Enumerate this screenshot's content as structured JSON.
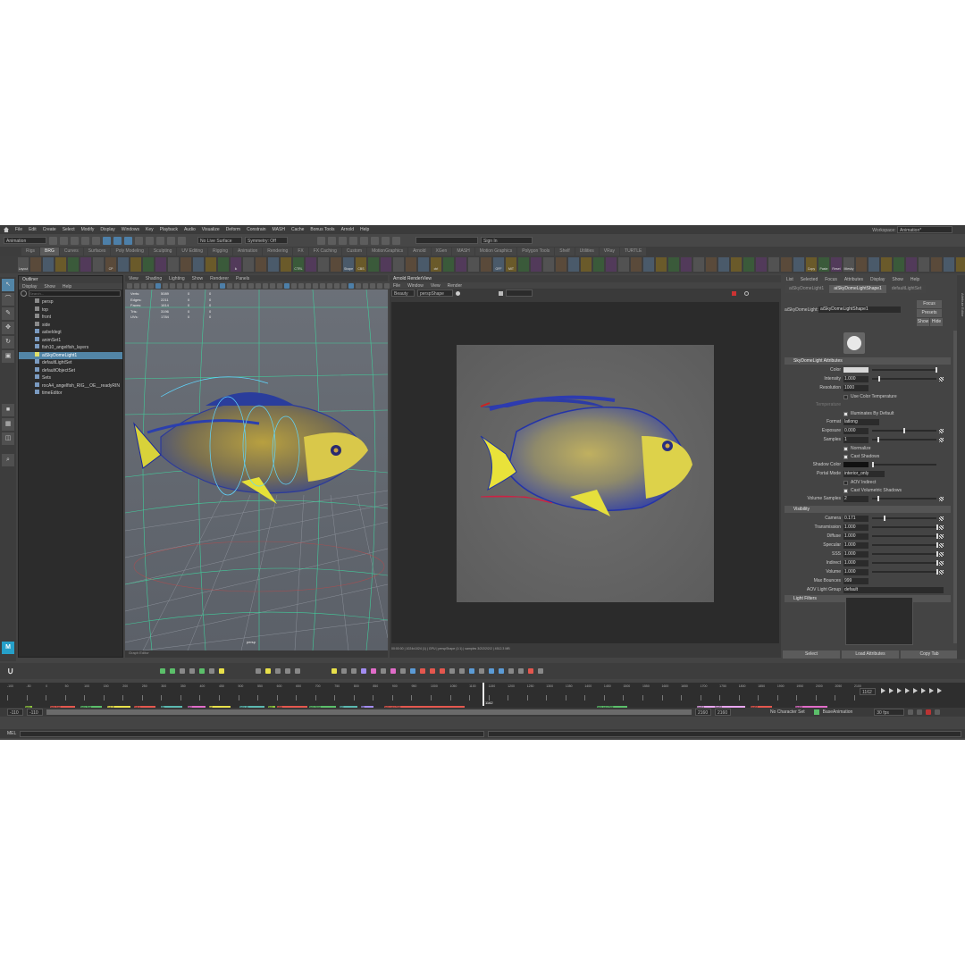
{
  "menubar": {
    "items": [
      "File",
      "Edit",
      "Create",
      "Select",
      "Modify",
      "Display",
      "Windows",
      "Key",
      "Playback",
      "Audio",
      "Visualize",
      "Deform",
      "Constrain",
      "MASH",
      "Cache",
      "Bonus Tools",
      "Arnold",
      "Help"
    ],
    "workspace_label": "Workspace:",
    "workspace_value": "Animation*"
  },
  "statusline": {
    "menuset": "Animation",
    "symmetry": "No Live Surface",
    "symmetry2": "Symmetry: Off",
    "signin": "Sign In"
  },
  "shelf": {
    "tabs": [
      "Rigs",
      "BRG",
      "Curves",
      "Surfaces",
      "Poly Modeling",
      "Sculpting",
      "UV Editing",
      "Rigging",
      "Animation",
      "Rendering",
      "FX",
      "FX Caching",
      "Custom",
      "MotionGraphics",
      "Arnold",
      "XGen",
      "MASH",
      "Motion Graphics",
      "Polygon Tools",
      "Shelf",
      "Utilities",
      "VRay",
      "TURTLE"
    ],
    "active_tab": "BRG",
    "items": [
      "Layout",
      "",
      "",
      "",
      "",
      "",
      "",
      "CP",
      "",
      "",
      "",
      "",
      "",
      "",
      "",
      "",
      "",
      "ik",
      "",
      "",
      "",
      "",
      "CTRL",
      "",
      "",
      "",
      "Shape",
      "CBS",
      "",
      "",
      "",
      "",
      "",
      "ctrl",
      "",
      "",
      "",
      "",
      "OFF",
      "MIT",
      "",
      "",
      "",
      "",
      "",
      "",
      "",
      "",
      "",
      "",
      "",
      "",
      "",
      "",
      "",
      "",
      "",
      "",
      "",
      "",
      "",
      "",
      "",
      "Copy Name",
      "Paste Name",
      "Reset ALL",
      "Miesky",
      "",
      "",
      "",
      "",
      "",
      "",
      "",
      "",
      "",
      "",
      "",
      "",
      "",
      "",
      "",
      "",
      "",
      "",
      "",
      "",
      ""
    ]
  },
  "outliner": {
    "title": "Outliner",
    "menus": [
      "Display",
      "Show",
      "Help"
    ],
    "search_placeholder": "Search...",
    "items": [
      "persp",
      "top",
      "front",
      "side",
      "asbeldegt",
      "animSet1",
      "fish10_angelfish_layers",
      "aiSkyDomeLight1",
      "defaultLightSet",
      "defaultObjectSet",
      "Sets",
      "rocA4_angelfish_RIG__OE__readyRIN",
      "timeEditor"
    ],
    "selected_index": 7
  },
  "viewport": {
    "menus": [
      "View",
      "Shading",
      "Lighting",
      "Show",
      "Renderer",
      "Panels"
    ],
    "hud_labels": [
      "Verts:",
      "Edges:",
      "Faces:",
      "Tris:",
      "UVs:"
    ],
    "hud_values": [
      "5089",
      "2211",
      "1614",
      "3196",
      "1784"
    ],
    "hud_zero": "0",
    "camera_label": "persp",
    "graph_editor": "Graph Editor"
  },
  "render_view": {
    "title": "Arnold RenderView",
    "menus": [
      "File",
      "Window",
      "View",
      "Render"
    ],
    "aov": "Beauty",
    "camera": "perspShape",
    "status": "00:00:00 | 1024x1024 (1) | GPU | perspShape (1:1) | samples 3/2/2/2/2/2 | 4512.3 MB"
  },
  "attribute_editor": {
    "menus": [
      "List",
      "Selected",
      "Focus",
      "Attributes",
      "Display",
      "Show",
      "Help"
    ],
    "tabs": [
      "aiSkyDomeLight1",
      "aiSkyDomeLightShape1",
      "defaultLightSet"
    ],
    "node_label": "aiSkyDomeLight:",
    "node_value": "aiSkyDomeLightShape1",
    "focus_btn": "Focus",
    "presets_btn": "Presets",
    "show_btn": "Show",
    "hide_btn": "Hide",
    "section1": "SkyDomeLight Attributes",
    "attrs1": [
      {
        "label": "Color",
        "value": ""
      },
      {
        "label": "Intensity",
        "value": "1.000"
      },
      {
        "label": "Resolution",
        "value": "1000"
      }
    ],
    "use_color_temp": "Use Color Temperature",
    "temperature_label": "Temperature",
    "illuminates": "Illuminates By Default",
    "format_label": "Format",
    "format_value": "latlong",
    "exposure_label": "Exposure",
    "exposure_value": "0.000",
    "samples_label": "Samples",
    "samples_value": "1",
    "normalize": "Normalize",
    "cast_shadows": "Cast Shadows",
    "shadow_color_label": "Shadow Color",
    "portal_label": "Portal Mode",
    "portal_value": "interior_only",
    "aov_indirect": "AOV Indirect",
    "cast_vol": "Cast Volumetric Shadows",
    "vol_samples_label": "Volume Samples",
    "vol_samples_value": "2",
    "section2": "Visibility",
    "vis": [
      {
        "label": "Camera",
        "value": "0.171"
      },
      {
        "label": "Transmission",
        "value": "1.000"
      },
      {
        "label": "Diffuse",
        "value": "1.000"
      },
      {
        "label": "Specular",
        "value": "1.000"
      },
      {
        "label": "SSS",
        "value": "1.000"
      },
      {
        "label": "Indirect",
        "value": "1.000"
      },
      {
        "label": "Volume",
        "value": "1.000"
      },
      {
        "label": "Max Bounces",
        "value": "999"
      }
    ],
    "aov_group_label": "AOV Light Group",
    "aov_group_value": "default",
    "section3": "Light Filters",
    "select_btn": "Select",
    "load_btn": "Load Attributes",
    "copy_btn": "Copy Tab",
    "side_tabs": [
      "Attribute Editor",
      "Channel Box / Layer Editor",
      "Modeling Toolkit"
    ]
  },
  "timeline": {
    "ticks": [
      "-100",
      "-50",
      "0",
      "50",
      "100",
      "150",
      "200",
      "250",
      "300",
      "350",
      "400",
      "450",
      "500",
      "550",
      "600",
      "650",
      "700",
      "750",
      "800",
      "850",
      "900",
      "950",
      "1000",
      "1050",
      "1100",
      "1150",
      "1200",
      "1250",
      "1300",
      "1350",
      "1400",
      "1450",
      "1500",
      "1550",
      "1600",
      "1650",
      "1700",
      "1750",
      "1800",
      "1850",
      "1900",
      "1950",
      "2000",
      "2050",
      "2100"
    ],
    "current_frame": "1162",
    "current_frame_box": "1162",
    "clips": [
      {
        "label": "Swim_",
        "color": "#8ec63f"
      },
      {
        "label": "Swim Fast",
        "color": "#e4574e"
      },
      {
        "label": "Swim Slow",
        "color": "#5bbf6a"
      },
      {
        "label": "Turn R",
        "color": "#e8e04a"
      },
      {
        "label": "Turn L",
        "color": "#e4574e"
      },
      {
        "label": "Idle",
        "color": "#5bb8b0"
      },
      {
        "label": "Dart",
        "color": "#e06cc8"
      },
      {
        "label": "Eat",
        "color": "#e8e04a"
      },
      {
        "label": "Swim Up",
        "color": "#5bb8b0"
      },
      {
        "label": "Stop",
        "color": "#8ec63f"
      },
      {
        "label": "Glide",
        "color": "#e4574e"
      },
      {
        "label": "Swim Down",
        "color": "#5bbf6a"
      },
      {
        "label": "Roll",
        "color": "#5bb8b0"
      },
      {
        "label": "Flip",
        "color": "#a28cf0"
      },
      {
        "label": "Swim Long Hold",
        "color": "#e4574e"
      },
      {
        "label": "Swim Long Hold",
        "color": "#5bbf6a"
      },
      {
        "label": "Death1",
        "color": "#e9a6f0"
      },
      {
        "label": "Death2",
        "color": "#e9a6f0"
      },
      {
        "label": "Death3",
        "color": "#e4574e"
      },
      {
        "label": "Death4",
        "color": "#e06cc8"
      }
    ]
  },
  "range": {
    "start": "-110",
    "start2": "-110",
    "end": "2160",
    "end2": "2160",
    "character_set": "No Character Set",
    "anim_layer": "BaseAnimation",
    "fps": "30 fps"
  },
  "cmdline": {
    "label": "MEL"
  }
}
